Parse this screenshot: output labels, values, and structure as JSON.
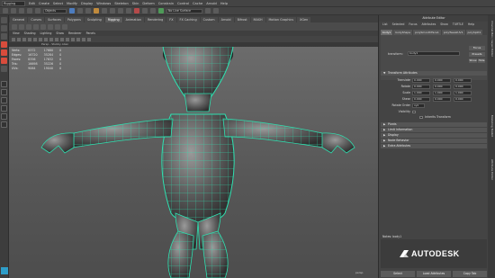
{
  "menubar": {
    "mode": "Rigging",
    "items": [
      "Edit",
      "Create",
      "Select",
      "Modify",
      "Display",
      "Windows",
      "Skeleton",
      "Skin",
      "Deform",
      "Constrain",
      "Control",
      "Cache",
      "Arnold",
      "Help"
    ]
  },
  "statusline": {
    "object_field": "Objects",
    "render_label": "No Live Surface"
  },
  "shelf": {
    "tabs": [
      "General",
      "Curves",
      "Surfaces",
      "Polygons",
      "Sculpting",
      "Rigging",
      "Animation",
      "Rendering",
      "FX",
      "FX Caching",
      "Custom",
      "Arnold",
      "Bifrost",
      "MASH",
      "Motion Graphics",
      "XGen"
    ],
    "active_tab": "Rigging"
  },
  "viewport": {
    "menu": [
      "View",
      "Shading",
      "Lighting",
      "Show",
      "Renderer",
      "Panels"
    ],
    "title": "Persp - Stubby Alien",
    "hud": [
      {
        "label": "Verts:",
        "a": "8372",
        "b": "17680",
        "c": "0"
      },
      {
        "label": "Edges:",
        "a": "16720",
        "b": "35284",
        "c": "0"
      },
      {
        "label": "Faces:",
        "a": "8356",
        "b": "17632",
        "c": "0"
      },
      {
        "label": "Tris:",
        "a": "16698",
        "b": "35226",
        "c": "0"
      },
      {
        "label": "UVs:",
        "a": "9064",
        "b": "19040",
        "c": "0"
      }
    ],
    "camera_label": "persp"
  },
  "attribute_editor": {
    "title": "Attribute Editor",
    "menu": [
      "List",
      "Selected",
      "Focus",
      "Attributes",
      "Show",
      "TURTLE",
      "Help"
    ],
    "tabs": [
      "body1",
      "bodyShape",
      "polySmoothFace1",
      "polyTweakUV1",
      "polySplit1"
    ],
    "active_tab": "body1",
    "node_label": "transform:",
    "node_value": "body1",
    "side_buttons": [
      "Focus",
      "Presets",
      "Show",
      "Hide"
    ],
    "sections": {
      "transform": "Transform Attributes",
      "pivots": "Pivots",
      "limit": "Limit Information",
      "display": "Display",
      "node_behavior": "Node Behavior",
      "extra": "Extra Attributes"
    },
    "transform_rows": [
      {
        "label": "Translate",
        "x": "0.000",
        "y": "0.000",
        "z": "0.000"
      },
      {
        "label": "Rotate",
        "x": "0.000",
        "y": "0.000",
        "z": "0.000"
      },
      {
        "label": "Scale",
        "x": "1.000",
        "y": "1.000",
        "z": "1.000"
      },
      {
        "label": "Shear",
        "x": "0.000",
        "y": "0.000",
        "z": "0.000"
      }
    ],
    "rotate_order_label": "Rotate Order",
    "rotate_order_value": "xyz",
    "visibility_label": "Visibility",
    "inherits_label": "Inherits Transform",
    "notes_label": "Notes: body1",
    "bottom_buttons": [
      "Select",
      "Load Attributes",
      "Copy Tab"
    ]
  },
  "side_tabs": [
    "Channel Box / Layer Editor",
    "Modeling Toolkit",
    "Attribute Editor"
  ],
  "brand": "AUTODESK",
  "colors": {
    "wire": "#2fe0b0",
    "accent": "#2f8fd0",
    "selected_tool": "#d84c3c"
  }
}
